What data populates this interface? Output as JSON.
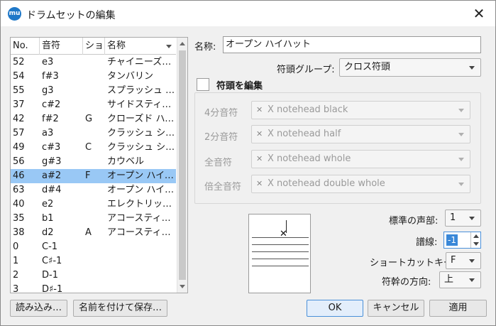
{
  "window": {
    "title": "ドラムセットの編集",
    "app_icon_text": "mu"
  },
  "list": {
    "headers": [
      "No.",
      "音符",
      "ショ",
      "名称"
    ],
    "rows": [
      {
        "no": "52",
        "note": "e3",
        "shortcut": "",
        "name": "チャイニーズシ…"
      },
      {
        "no": "54",
        "note": "f#3",
        "shortcut": "",
        "name": "タンバリン"
      },
      {
        "no": "55",
        "note": "g3",
        "shortcut": "",
        "name": "スプラッシュ シ…"
      },
      {
        "no": "37",
        "note": "c#2",
        "shortcut": "",
        "name": "サイドスティック"
      },
      {
        "no": "42",
        "note": "f#2",
        "shortcut": "G",
        "name": "クローズド ハイ…"
      },
      {
        "no": "57",
        "note": "a3",
        "shortcut": "",
        "name": "クラッシュ シン…"
      },
      {
        "no": "49",
        "note": "c#3",
        "shortcut": "C",
        "name": "クラッシュ シン…"
      },
      {
        "no": "56",
        "note": "g#3",
        "shortcut": "",
        "name": "カウベル"
      },
      {
        "no": "46",
        "note": "a#2",
        "shortcut": "F",
        "name": "オープン ハイハ…",
        "selected": true
      },
      {
        "no": "63",
        "note": "d#4",
        "shortcut": "",
        "name": "オープン ハイ …"
      },
      {
        "no": "40",
        "note": "e2",
        "shortcut": "",
        "name": "エレクトリック …"
      },
      {
        "no": "35",
        "note": "b1",
        "shortcut": "",
        "name": "アコースティッ…"
      },
      {
        "no": "38",
        "note": "d2",
        "shortcut": "A",
        "name": "アコースティッ…"
      },
      {
        "no": "0",
        "note": "C-1",
        "shortcut": "",
        "name": ""
      },
      {
        "no": "1",
        "note": "C♯-1",
        "shortcut": "",
        "name": ""
      },
      {
        "no": "2",
        "note": "D-1",
        "shortcut": "",
        "name": ""
      },
      {
        "no": "3",
        "note": "D♯-1",
        "shortcut": "",
        "name": ""
      }
    ]
  },
  "buttons": {
    "load": "読み込み…",
    "save_as": "名前を付けて保存…",
    "ok": "OK",
    "cancel": "キャンセル",
    "apply": "適用"
  },
  "form": {
    "name_label": "名称:",
    "name_value": "オープン ハイハット",
    "notehead_group_label": "符頭グループ:",
    "notehead_group_value": "クロス符頭",
    "edit_noteheads_label": "符頭を編集",
    "quarter_label": "4分音符",
    "quarter_value": "X notehead black",
    "half_label": "2分音符",
    "half_value": "X notehead half",
    "whole_label": "全音符",
    "whole_value": "X notehead whole",
    "breve_label": "倍全音符",
    "breve_value": "X notehead double whole",
    "voice_label": "標準の声部:",
    "voice_value": "1",
    "line_label": "譜線:",
    "line_value": "-1",
    "shortcut_label": "ショートカットキー:",
    "shortcut_value": "F",
    "stem_label": "符幹の方向:",
    "stem_value": "上"
  }
}
